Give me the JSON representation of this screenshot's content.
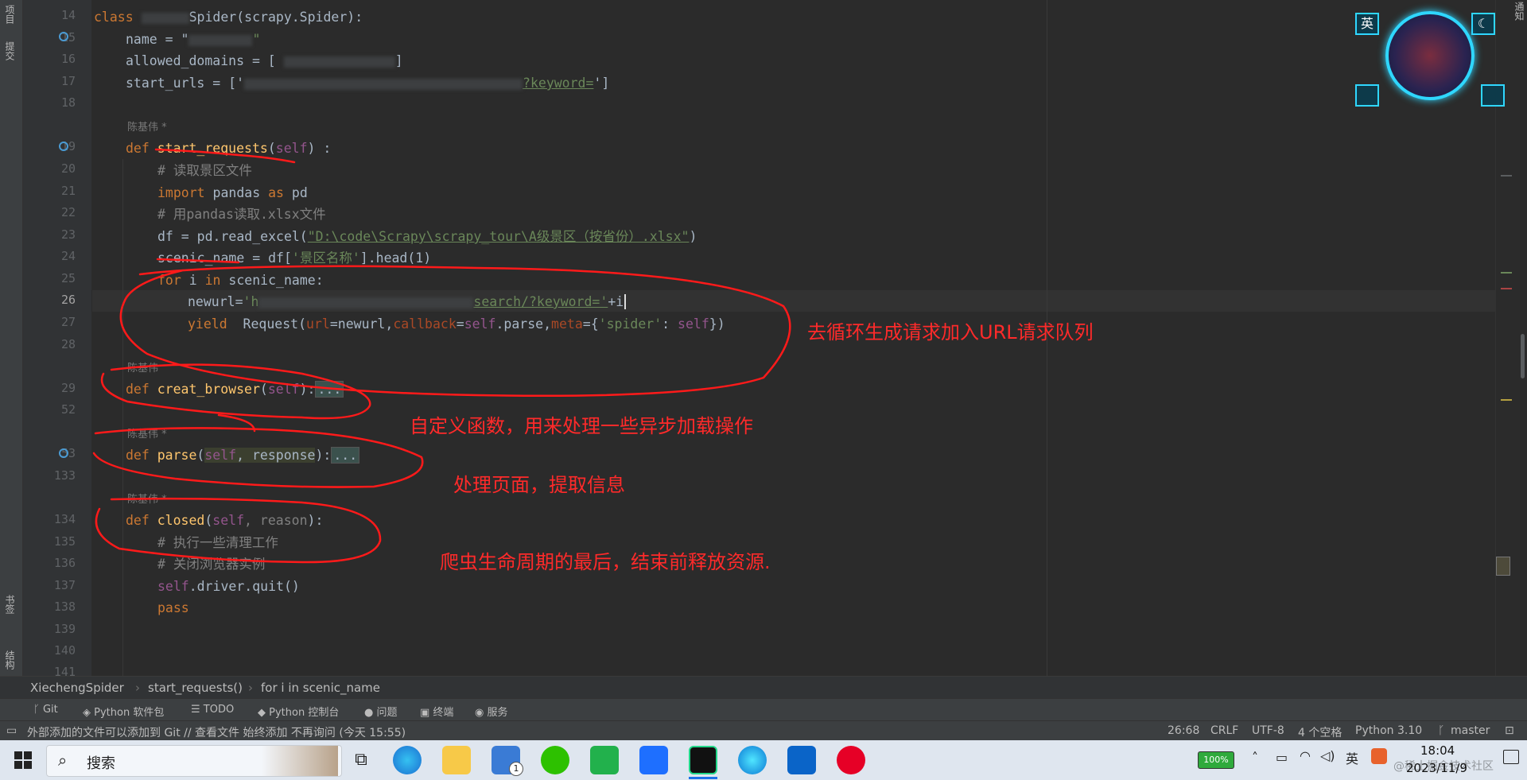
{
  "left_strip": {
    "top_label": "项目",
    "commit_label": "提交",
    "bookmarks_label": "书签",
    "structure_label": "结构"
  },
  "right_strip": {
    "notifications_label": "通知"
  },
  "editor": {
    "line_numbers": [
      "14",
      "15",
      "16",
      "17",
      "18",
      "",
      "19",
      "20",
      "21",
      "22",
      "23",
      "24",
      "25",
      "26",
      "27",
      "28",
      "",
      "29",
      "52",
      "",
      "53",
      "133",
      "",
      "134",
      "135",
      "136",
      "137",
      "138",
      "139",
      "140",
      "141"
    ],
    "lines": {
      "l14_class": "class",
      "l14_rest": "Spider(scrapy.Spider):",
      "l15_name": "name = \"",
      "l15_end": "\"",
      "l16": "allowed_domains = [",
      "l16_end": "]",
      "l17": "start_urls = ['",
      "l17_str": "?keyword=",
      "l17_end": "']",
      "author1": "陈基伟 *",
      "l19_def": "def ",
      "l19_fn": "start_requests",
      "l19_p1": "(",
      "l19_self": "self",
      "l19_p2": ") :",
      "l20": "# 读取景区文件",
      "l21_import": "import",
      "l21_mid": " pandas ",
      "l21_as": "as",
      "l21_end": " pd",
      "l22": "# 用pandas读取.xlsx文件",
      "l23_a": "df = pd.read_excel(",
      "l23_str": "\"D:\\code\\Scrapy\\scrapy_tour\\A级景区（按省份）.xlsx\"",
      "l23_b": ")",
      "l24_a": "scenic_name = df[",
      "l24_str": "'景区名称'",
      "l24_b": "].head(1)",
      "l25_for": "for",
      "l25_mid": " i ",
      "l25_in": "in",
      "l25_end": " scenic_name:",
      "l26_a": "newurl=",
      "l26_str_a": "'h",
      "l26_str_b": "search/?keyword='",
      "l26_b": "+i",
      "l27_yield": "yield",
      "l27_a": "  Request(",
      "l27_url": "url",
      "l27_b": "=newurl,",
      "l27_cb": "callback",
      "l27_c": "=",
      "l27_self": "self",
      "l27_d": ".parse,",
      "l27_meta": "meta",
      "l27_e": "={",
      "l27_key": "'spider'",
      "l27_f": ": ",
      "l27_self2": "self",
      "l27_g": "})",
      "author2": "陈基伟",
      "l29_def": "def ",
      "l29_fn": "creat_browser",
      "l29_p1": "(",
      "l29_self": "self",
      "l29_p2": "):",
      "l29_fold": "...",
      "author3": "陈基伟 *",
      "l53_def": "def ",
      "l53_fn": "parse",
      "l53_p1": "(",
      "l53_self": "self",
      "l53_params": ", response",
      "l53_p2": "):",
      "l53_fold": "...",
      "author4": "陈基伟 *",
      "l134_def": "def ",
      "l134_fn": "closed",
      "l134_p1": "(",
      "l134_self": "self",
      "l134_params": ", reason",
      "l134_p2": "):",
      "l135": "# 执行一些清理工作",
      "l136": "# 关闭浏览器实例",
      "l137_self": "self",
      "l137_rest": ".driver.quit()",
      "l138": "pass"
    }
  },
  "annotations": {
    "a1": "去循环生成请求加入URL请求队列",
    "a2": "自定义函数，用来处理一些异步加载操作",
    "a3": "处理页面，提取信息",
    "a4": "爬虫生命周期的最后，结束前释放资源."
  },
  "breadcrumb": {
    "items": [
      "XiechengSpider",
      "start_requests()",
      "for i in scenic_name"
    ]
  },
  "tool_windows": {
    "git": "Git",
    "python_packages": "Python 软件包",
    "todo": "TODO",
    "python_console": "Python 控制台",
    "problems": "问题",
    "terminal": "终端",
    "services": "服务"
  },
  "status": {
    "message": "外部添加的文件可以添加到 Git // 查看文件   始终添加   不再询问 (今天 15:55)",
    "position": "26:68",
    "line_sep": "CRLF",
    "encoding": "UTF-8",
    "indent": "4 个空格",
    "interpreter": "Python 3.10",
    "branch": "master"
  },
  "widget": {
    "lang": "英"
  },
  "taskbar": {
    "search_label": "搜索",
    "battery": "100%",
    "ime": "英",
    "time": "18:04",
    "date": "2023/11/9",
    "mail_badge": "1",
    "watermark": "@稀土掘金技术社区"
  },
  "colors": {
    "accent_red": "#ff2a2a",
    "editor_bg": "#2b2b2b",
    "keyword": "#cc7832",
    "function": "#ffc66d",
    "string": "#6a8759",
    "comment": "#808080"
  }
}
